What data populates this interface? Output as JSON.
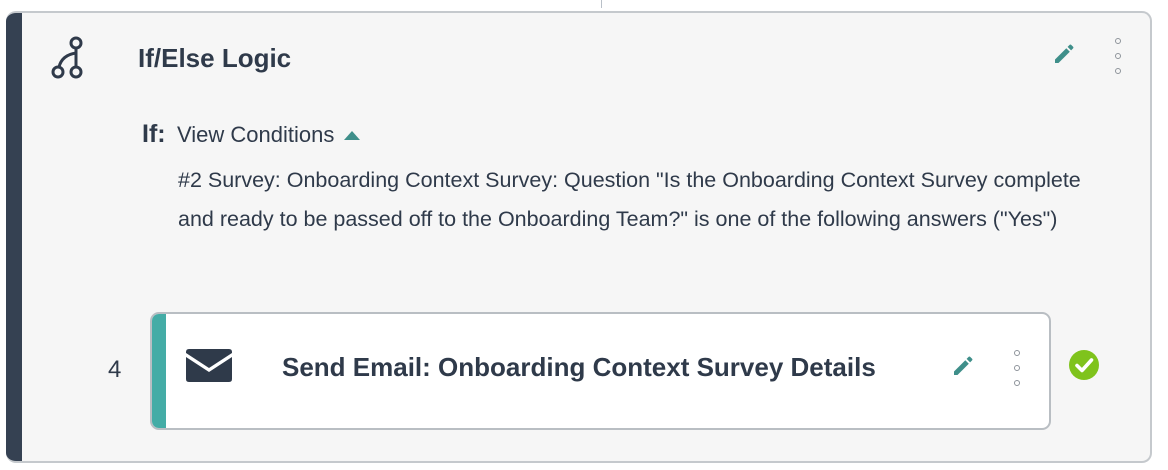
{
  "card": {
    "title": "If/Else Logic",
    "icon": "branch-logic-icon",
    "accent_color": "#354152"
  },
  "condition": {
    "if_label": "If:",
    "toggle_label": "View Conditions",
    "toggle_icon": "caret-up-icon",
    "text": "#2 Survey: Onboarding Context Survey: Question \"Is the Onboarding Context Survey complete and ready to be passed off to the Onboarding Team?\" is one of the following answers (\"Yes\")"
  },
  "step": {
    "number": "4",
    "icon": "envelope-icon",
    "title": "Send Email: Onboarding Context Survey Details",
    "accent_color": "#44aca6",
    "status_icon": "check-circle-icon",
    "status_color": "#7fc31c"
  },
  "actions": {
    "edit_icon": "pencil-icon",
    "more_icon": "kebab-menu-icon",
    "edit_color": "#3f8f8a"
  }
}
